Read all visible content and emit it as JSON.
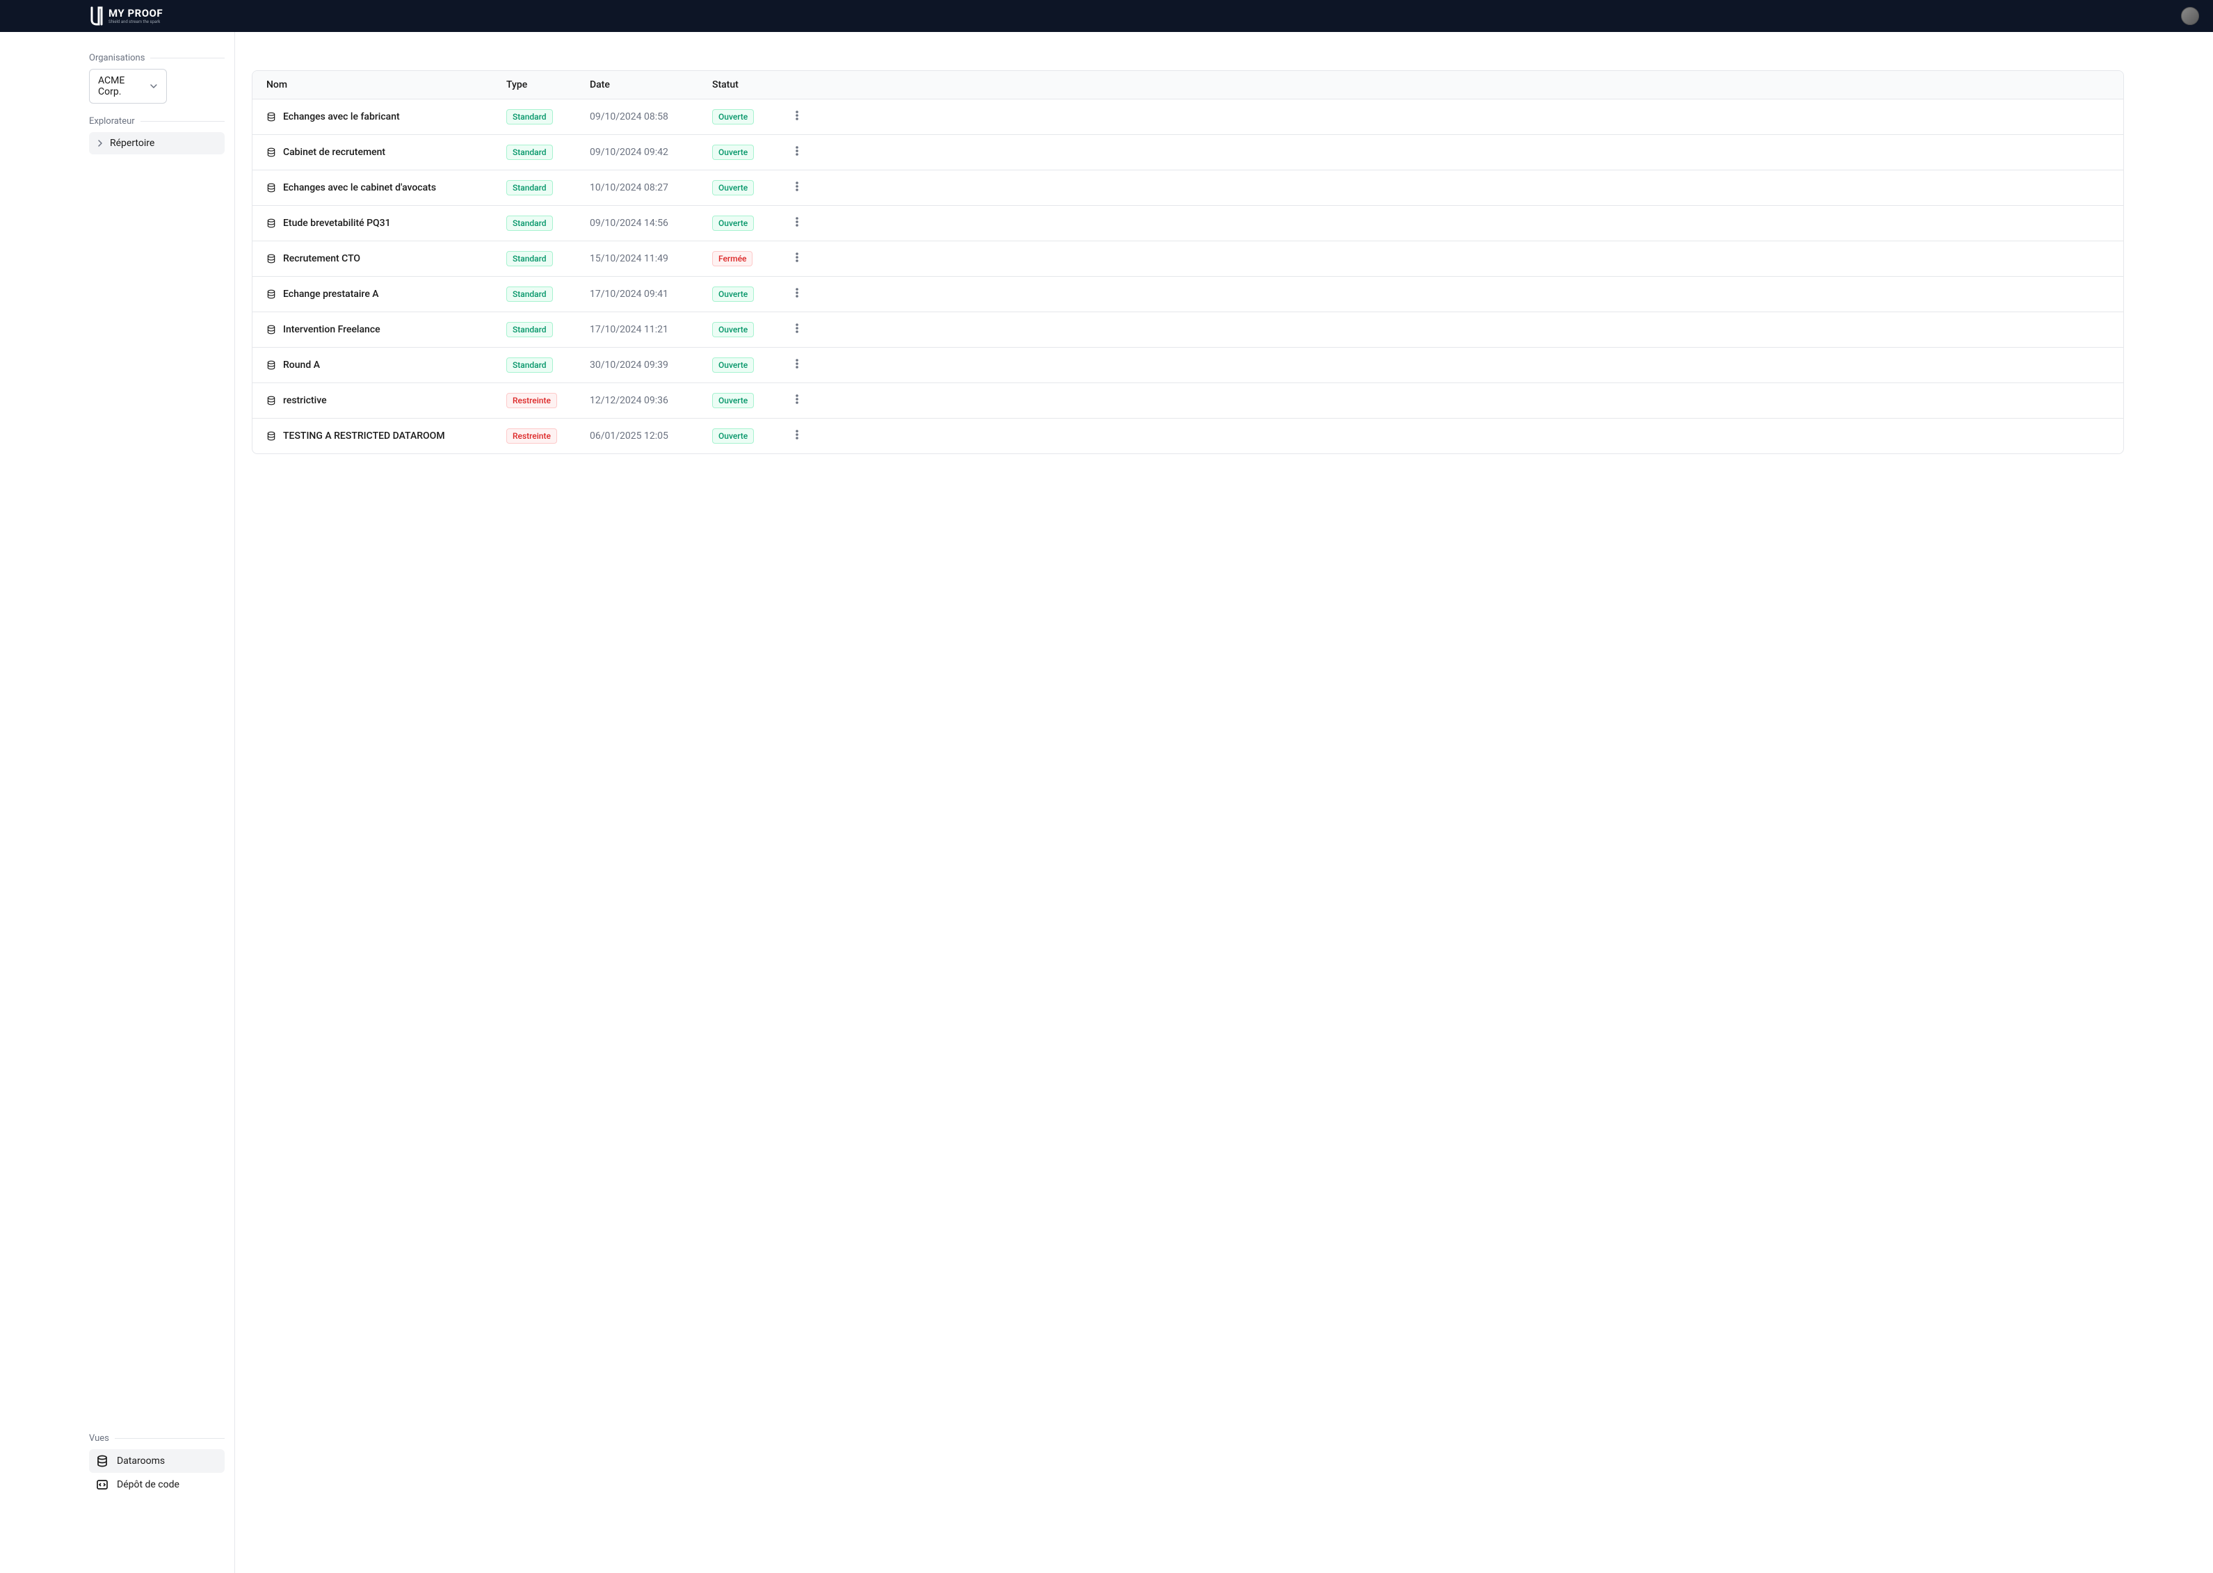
{
  "header": {
    "brand": "MY PROOF",
    "tagline": "Shield and stream the spark"
  },
  "sidebar": {
    "organisations_label": "Organisations",
    "selected_org": "ACME Corp.",
    "explorer_label": "Explorateur",
    "tree_root": "Répertoire",
    "vues_label": "Vues",
    "vues": [
      {
        "label": "Datarooms",
        "active": true,
        "icon": "database"
      },
      {
        "label": "Dépôt de code",
        "active": false,
        "icon": "code"
      }
    ]
  },
  "table": {
    "headers": {
      "name": "Nom",
      "type": "Type",
      "date": "Date",
      "status": "Statut"
    },
    "rows": [
      {
        "name": "Echanges avec le fabricant",
        "type": "Standard",
        "type_color": "green",
        "date": "09/10/2024 08:58",
        "status": "Ouverte",
        "status_color": "green"
      },
      {
        "name": "Cabinet de recrutement",
        "type": "Standard",
        "type_color": "green",
        "date": "09/10/2024 09:42",
        "status": "Ouverte",
        "status_color": "green"
      },
      {
        "name": "Echanges avec le cabinet d'avocats",
        "type": "Standard",
        "type_color": "green",
        "date": "10/10/2024 08:27",
        "status": "Ouverte",
        "status_color": "green"
      },
      {
        "name": "Etude brevetabilité PQ31",
        "type": "Standard",
        "type_color": "green",
        "date": "09/10/2024 14:56",
        "status": "Ouverte",
        "status_color": "green"
      },
      {
        "name": "Recrutement CTO",
        "type": "Standard",
        "type_color": "green",
        "date": "15/10/2024 11:49",
        "status": "Fermée",
        "status_color": "red"
      },
      {
        "name": "Echange prestataire A",
        "type": "Standard",
        "type_color": "green",
        "date": "17/10/2024 09:41",
        "status": "Ouverte",
        "status_color": "green"
      },
      {
        "name": "Intervention Freelance",
        "type": "Standard",
        "type_color": "green",
        "date": "17/10/2024 11:21",
        "status": "Ouverte",
        "status_color": "green"
      },
      {
        "name": "Round A",
        "type": "Standard",
        "type_color": "green",
        "date": "30/10/2024 09:39",
        "status": "Ouverte",
        "status_color": "green"
      },
      {
        "name": "restrictive",
        "type": "Restreinte",
        "type_color": "red",
        "date": "12/12/2024 09:36",
        "status": "Ouverte",
        "status_color": "green"
      },
      {
        "name": "TESTING A RESTRICTED DATAROOM",
        "type": "Restreinte",
        "type_color": "red",
        "date": "06/01/2025 12:05",
        "status": "Ouverte",
        "status_color": "green"
      }
    ]
  }
}
